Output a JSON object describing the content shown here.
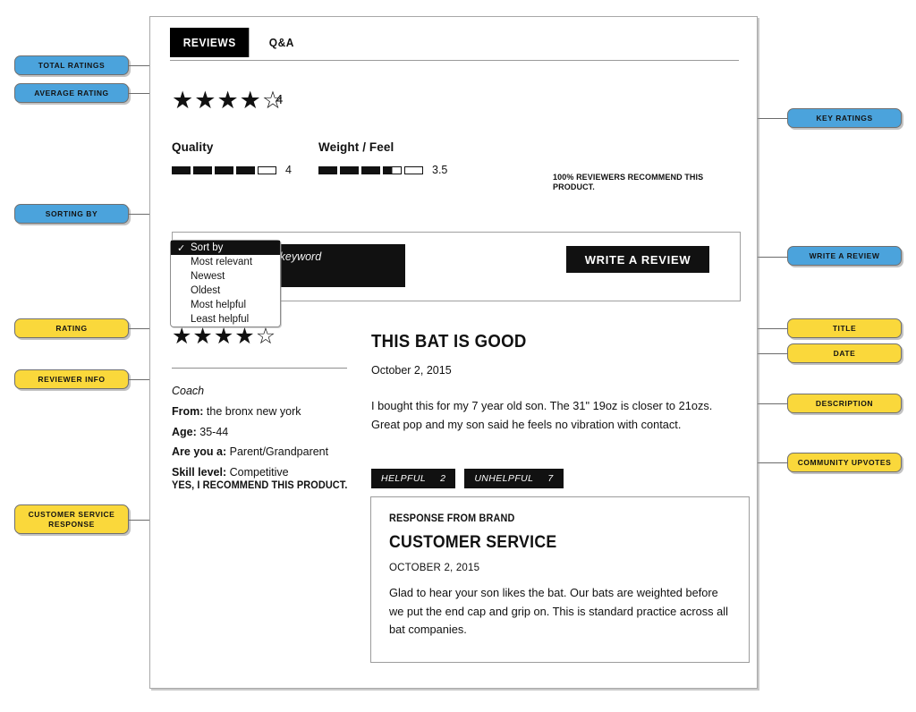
{
  "tabs": [
    {
      "label": "REVIEWS",
      "active": true
    },
    {
      "label": "Q&A",
      "active": false
    }
  ],
  "hero": {
    "average_rating": 4,
    "stars_filled": 4,
    "stars_total": 5,
    "total_ratings": "4"
  },
  "key_ratings": [
    {
      "label": "Quality",
      "value": "4",
      "filled": 4,
      "half": 0,
      "total": 5
    },
    {
      "label": "Weight / Feel",
      "value": "3.5",
      "filled": 3,
      "half": 1,
      "total": 5
    }
  ],
  "recommend_summary": "100% REVIEWERS RECOMMEND THIS PRODUCT.",
  "search": {
    "placeholder": "Enter phrase or keyword",
    "value": "",
    "icon": "search-icon"
  },
  "write_review_button": "WRITE A REVIEW",
  "sort_dropdown": {
    "selected": "Sort by",
    "options": [
      "Sort by",
      "Most relevant",
      "Newest",
      "Oldest",
      "Most helpful",
      "Least helpful"
    ]
  },
  "review": {
    "stars_filled": 4,
    "stars_total": 5,
    "title": "THIS BAT IS GOOD",
    "date": "October 2, 2015",
    "body": "I bought this for my 7 year old son. The 31\" 19oz is closer to 21ozs. Great pop and my son said he feels no vibration with contact.",
    "reviewer": {
      "nickname": "Coach",
      "from_label": "From:",
      "from_value": "the bronx new york",
      "age_label": "Age:",
      "age_value": "35-44",
      "areyou_label": "Are you a:",
      "areyou_value": "Parent/Grandparent",
      "skill_label": "Skill level:",
      "skill_value": "Competitive",
      "recommend": "YES, I RECOMMEND THIS PRODUCT."
    },
    "votes": [
      {
        "label": "HELPFUL",
        "count": "2"
      },
      {
        "label": "UNHELPFUL",
        "count": "7"
      }
    ]
  },
  "brand_response": {
    "eyebrow": "RESPONSE FROM BRAND",
    "name": "CUSTOMER SERVICE",
    "date": "OCTOBER 2, 2015",
    "body": "Glad to hear your son likes the bat. Our bats are weighted before we put the end cap and grip on. This is standard practice across all bat companies."
  },
  "annotations": {
    "colors": {
      "blue": "#4BA3DC",
      "yellow": "#FAD83B"
    },
    "left": [
      {
        "key": "total_ratings",
        "label": "TOTAL RATINGS",
        "color": "blue"
      },
      {
        "key": "average_rating",
        "label": "AVERAGE RATING",
        "color": "blue"
      },
      {
        "key": "sorting_by",
        "label": "SORTING BY",
        "color": "blue"
      },
      {
        "key": "rating",
        "label": "RATING",
        "color": "yellow"
      },
      {
        "key": "reviewer_info",
        "label": "REVIEWER INFO",
        "color": "yellow"
      },
      {
        "key": "cs_response",
        "label": "CUSTOMER SERVICE RESPONSE",
        "color": "yellow"
      }
    ],
    "right": [
      {
        "key": "key_ratings",
        "label": "KEY RATINGS",
        "color": "blue"
      },
      {
        "key": "write_a_review",
        "label": "WRITE A REVIEW",
        "color": "blue"
      },
      {
        "key": "title",
        "label": "TITLE",
        "color": "yellow"
      },
      {
        "key": "date",
        "label": "DATE",
        "color": "yellow"
      },
      {
        "key": "description",
        "label": "DESCRIPTION",
        "color": "yellow"
      },
      {
        "key": "upvotes",
        "label": "COMMUNITY UPVOTES",
        "color": "yellow"
      }
    ]
  }
}
